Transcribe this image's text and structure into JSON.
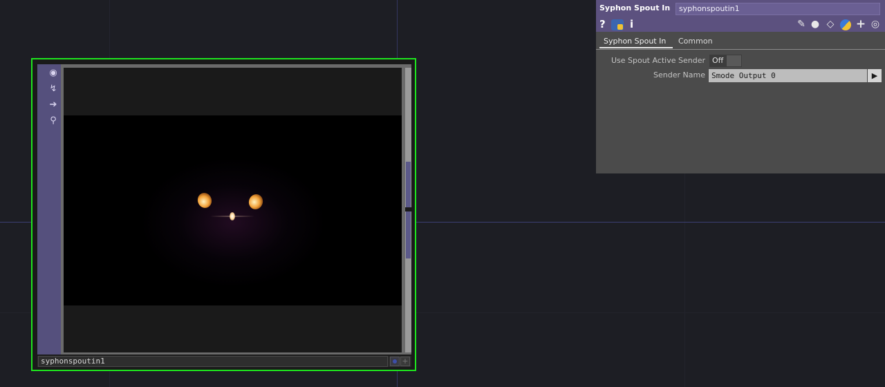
{
  "node": {
    "name": "syphonspoutin1",
    "side_icons": [
      "viewer-toggle-icon",
      "bypass-icon",
      "output-arrow-icon",
      "lock-icon"
    ]
  },
  "panel": {
    "op_type": "Syphon Spout In",
    "op_name": "syphonspoutin1",
    "toolbar": {
      "help": "?",
      "info": "i",
      "right_icons": [
        "edit-icon",
        "comment-icon",
        "clone-icon",
        "python-icon",
        "add-icon",
        "target-icon"
      ]
    },
    "tabs": [
      {
        "label": "Syphon Spout In",
        "active": true
      },
      {
        "label": "Common",
        "active": false
      }
    ],
    "params": {
      "use_active_sender": {
        "label": "Use Spout Active Sender",
        "value": "Off"
      },
      "sender_name": {
        "label": "Sender Name",
        "value": "Smode Output 0",
        "button": "▶"
      }
    }
  },
  "colors": {
    "accent_node_border": "#1ee61e",
    "header_purple": "#5c517f",
    "background": "#1d1e24"
  }
}
